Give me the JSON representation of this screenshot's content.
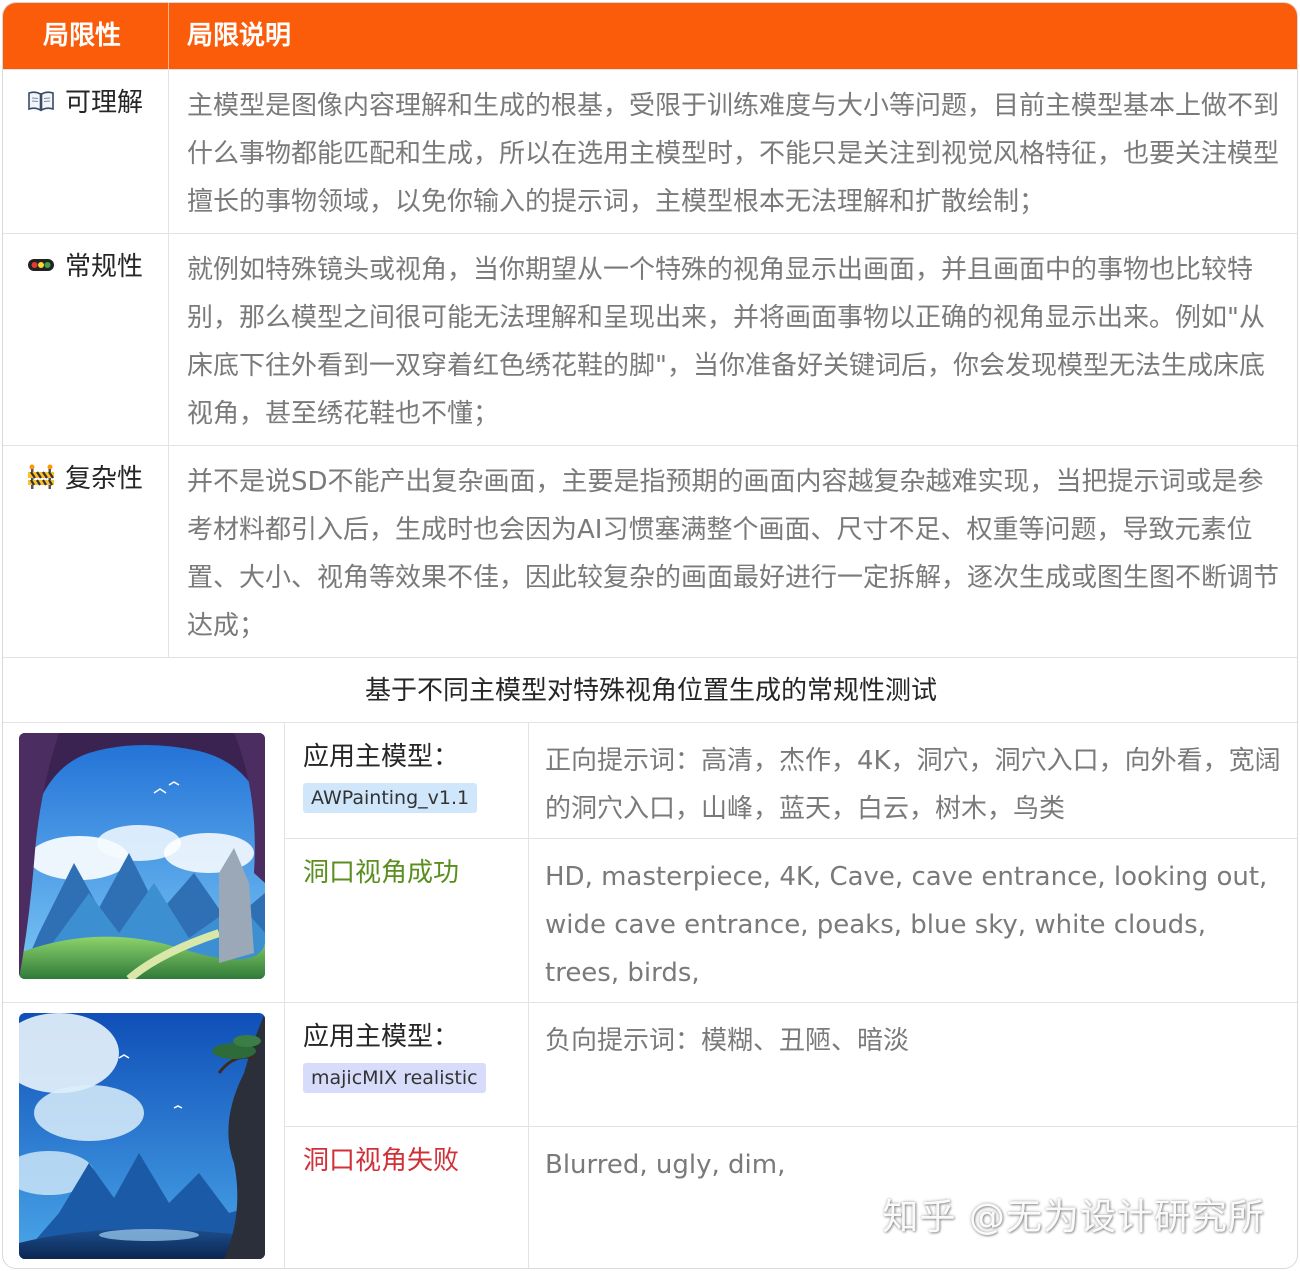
{
  "table": {
    "header": {
      "col1": "局限性",
      "col2": "局限说明"
    },
    "rows": [
      {
        "icon": "open-book-icon",
        "label": "可理解",
        "text": "主模型是图像内容理解和生成的根基，受限于训练难度与大小等问题，目前主模型基本上做不到什么事物都能匹配和生成，所以在选用主模型时，不能只是关注到视觉风格特征，也要关注模型擅长的事物领域，以免你输入的提示词，主模型根本无法理解和扩散绘制；"
      },
      {
        "icon": "traffic-light-icon",
        "label": "常规性",
        "text": "就例如特殊镜头或视角，当你期望从一个特殊的视角显示出画面，并且画面中的事物也比较特别，那么模型之间很可能无法理解和呈现出来，并将画面事物以正确的视角显示出来。例如\"从床底下往外看到一双穿着红色绣花鞋的脚\"，当你准备好关键词后，你会发现模型无法生成床底视角，甚至绣花鞋也不懂；"
      },
      {
        "icon": "construction-barrier-icon",
        "label": "复杂性",
        "text": "并不是说SD不能产出复杂画面，主要是指预期的画面内容越复杂越难实现，当把提示词或是参考材料都引入后，生成时也会因为AI习惯塞满整个画面、尺寸不足、权重等问题，导致元素位置、大小、视角等效果不佳，因此较复杂的画面最好进行一定拆解，逐次生成或图生图不断调节达成；"
      }
    ]
  },
  "caption": "基于不同主模型对特殊视角位置生成的常规性测试",
  "comparison": [
    {
      "model_label": "应用主模型：",
      "model_name": "AWPainting_v1.1",
      "result": "洞口视角成功",
      "prompt_cn": "正向提示词：高清，杰作，4K，洞穴，洞穴入口，向外看，宽阔的洞穴入口，山峰，蓝天，白云，树木，鸟类",
      "prompt_en": "HD, masterpiece, 4K, Cave, cave entrance, looking out, wide cave entrance, peaks, blue sky, white clouds, trees, birds,"
    },
    {
      "model_label": "应用主模型：",
      "model_name": "majicMIX realistic",
      "result": "洞口视角失败",
      "prompt_cn": "负向提示词：模糊、丑陋、暗淡",
      "prompt_en": "Blurred, ugly, dim,"
    }
  ],
  "watermark": "知乎 @无为设计研究所",
  "colors": {
    "header": "#fa5c0a",
    "success": "#5a8e1f",
    "fail": "#d03038",
    "tag_blue": "#cfe6fb",
    "tag_purple": "#d8dcfb"
  }
}
